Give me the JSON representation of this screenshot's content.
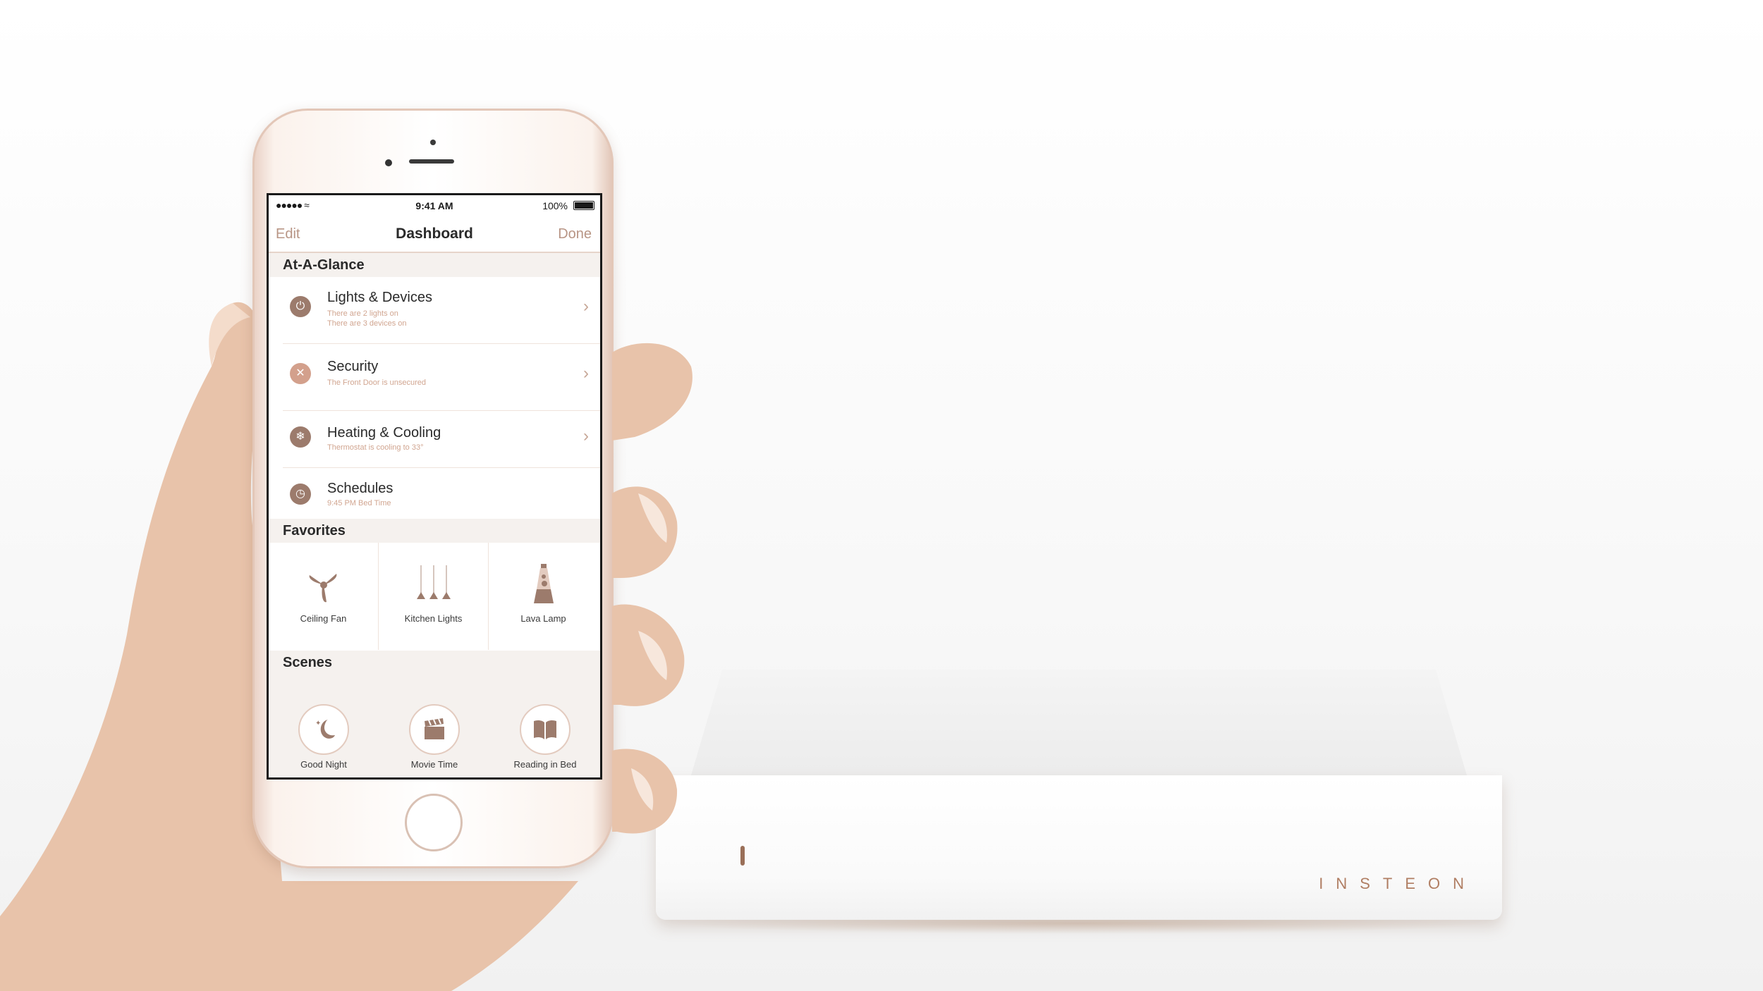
{
  "statusbar": {
    "signal": "●●●●● ≈",
    "time": "9:41 AM",
    "battery": "100%"
  },
  "navbar": {
    "edit": "Edit",
    "title": "Dashboard",
    "done": "Done"
  },
  "sections": {
    "at_a_glance": "At-A-Glance",
    "favorites": "Favorites",
    "scenes": "Scenes"
  },
  "glance": [
    {
      "title": "Lights & Devices",
      "sub1": "There are 2 lights on",
      "sub2": "There are 3 devices on",
      "icon": "power-icon"
    },
    {
      "title": "Security",
      "sub1": "The Front Door is unsecured",
      "icon": "x-icon"
    },
    {
      "title": "Heating & Cooling",
      "sub1": "Thermostat is cooling to 33°",
      "icon": "snowflake-icon"
    },
    {
      "title": "Schedules",
      "sub1": "9:45 PM Bed Time",
      "icon": "clock-icon"
    }
  ],
  "favorites": [
    {
      "label": "Ceiling Fan",
      "icon": "fan-icon"
    },
    {
      "label": "Kitchen Lights",
      "icon": "pendant-lights-icon"
    },
    {
      "label": "Lava Lamp",
      "icon": "lava-lamp-icon"
    }
  ],
  "scenes": [
    {
      "label": "Good Night",
      "icon": "moon-icon"
    },
    {
      "label": "Movie Time",
      "icon": "clapperboard-icon"
    },
    {
      "label": "Reading in Bed",
      "icon": "book-icon"
    }
  ],
  "hub": {
    "brand": "INSTEON"
  },
  "colors": {
    "accent": "#b89585",
    "icon_brown": "#9c7b6c",
    "icon_pink": "#d3a08c",
    "section_bg": "#f5f1ee"
  }
}
